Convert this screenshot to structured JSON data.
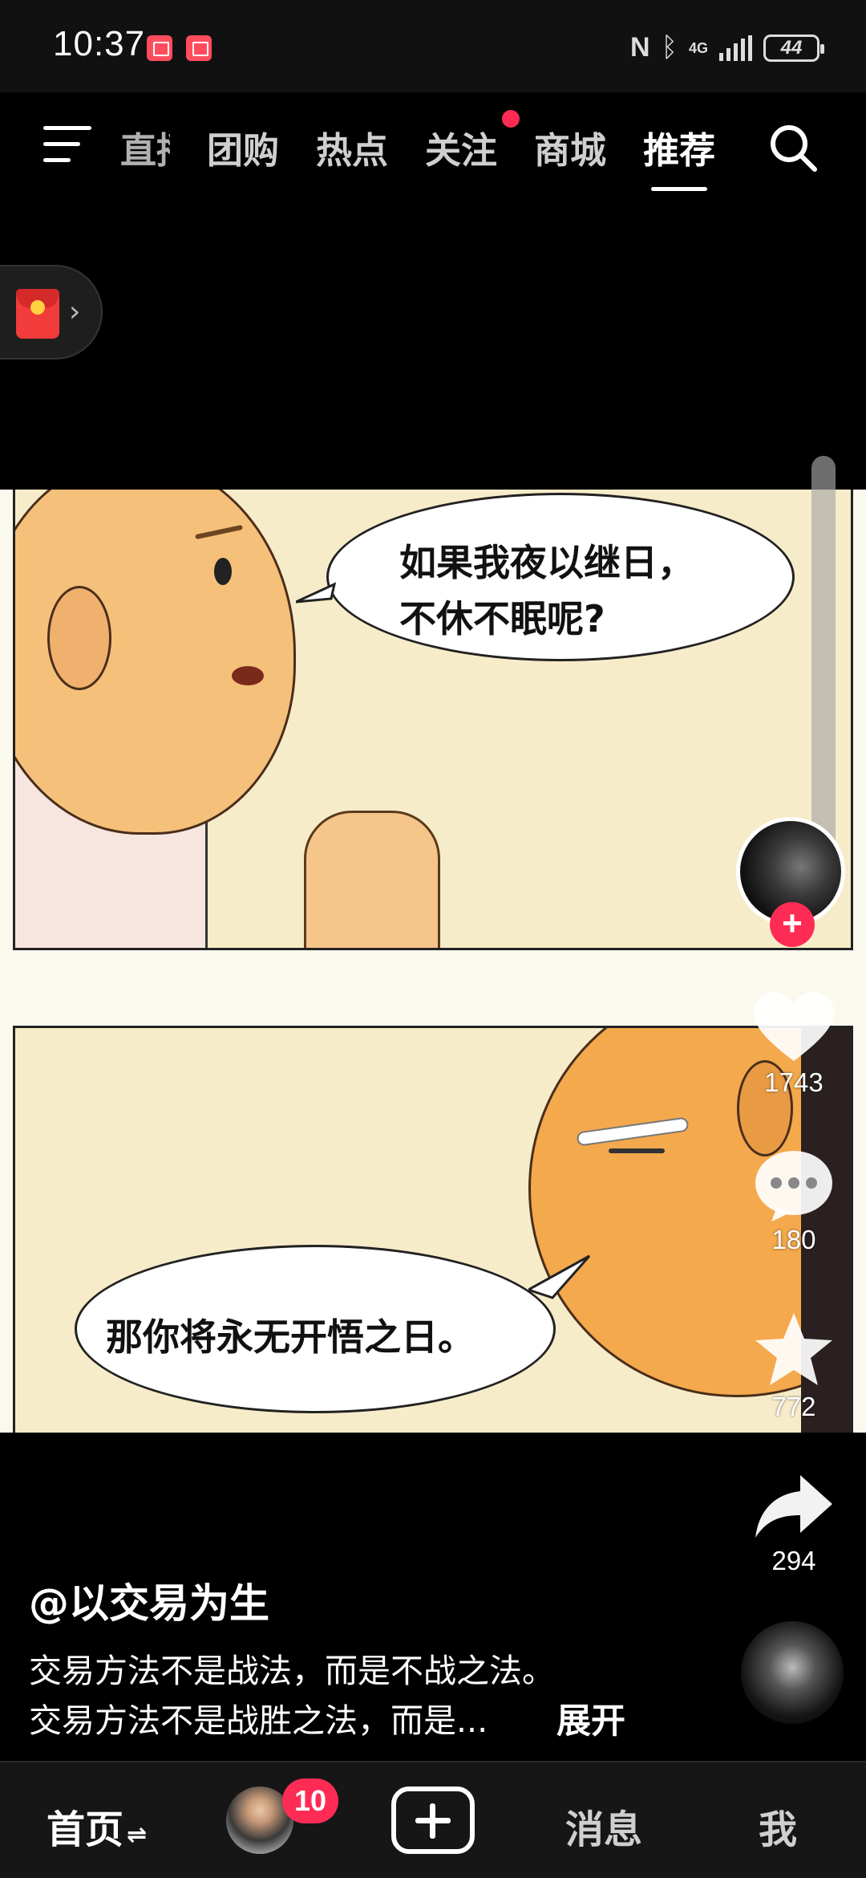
{
  "status_bar": {
    "time": "10:37",
    "network": "4G",
    "battery": "44"
  },
  "top_nav": {
    "tabs": [
      {
        "label": "直播",
        "active": false
      },
      {
        "label": "团购",
        "active": false
      },
      {
        "label": "热点",
        "active": false
      },
      {
        "label": "关注",
        "active": false,
        "has_dot": true
      },
      {
        "label": "商城",
        "active": false
      },
      {
        "label": "推荐",
        "active": true
      }
    ]
  },
  "video": {
    "comic": {
      "panel1_text_line1": "如果我夜以继日，",
      "panel1_text_line2": "不休不眠呢?",
      "panel2_text": "那你将永无开悟之日。"
    },
    "actions": {
      "likes": "1743",
      "comments": "180",
      "favorites": "772",
      "shares": "294"
    },
    "author": "@以交易为生",
    "description_line1": "交易方法不是战法，而是不战之法。",
    "description_line2": "交易方法不是战胜之法，而是...",
    "expand_label": "展开"
  },
  "bottom_nav": {
    "home_label": "首页",
    "home_suffix": "⇌",
    "friends_badge": "10",
    "messages_label": "消息",
    "me_label": "我"
  },
  "colors": {
    "accent": "#fe2c55",
    "background": "#000000",
    "comic_bg": "#f7ecc9",
    "skin": "#f4a94d"
  }
}
